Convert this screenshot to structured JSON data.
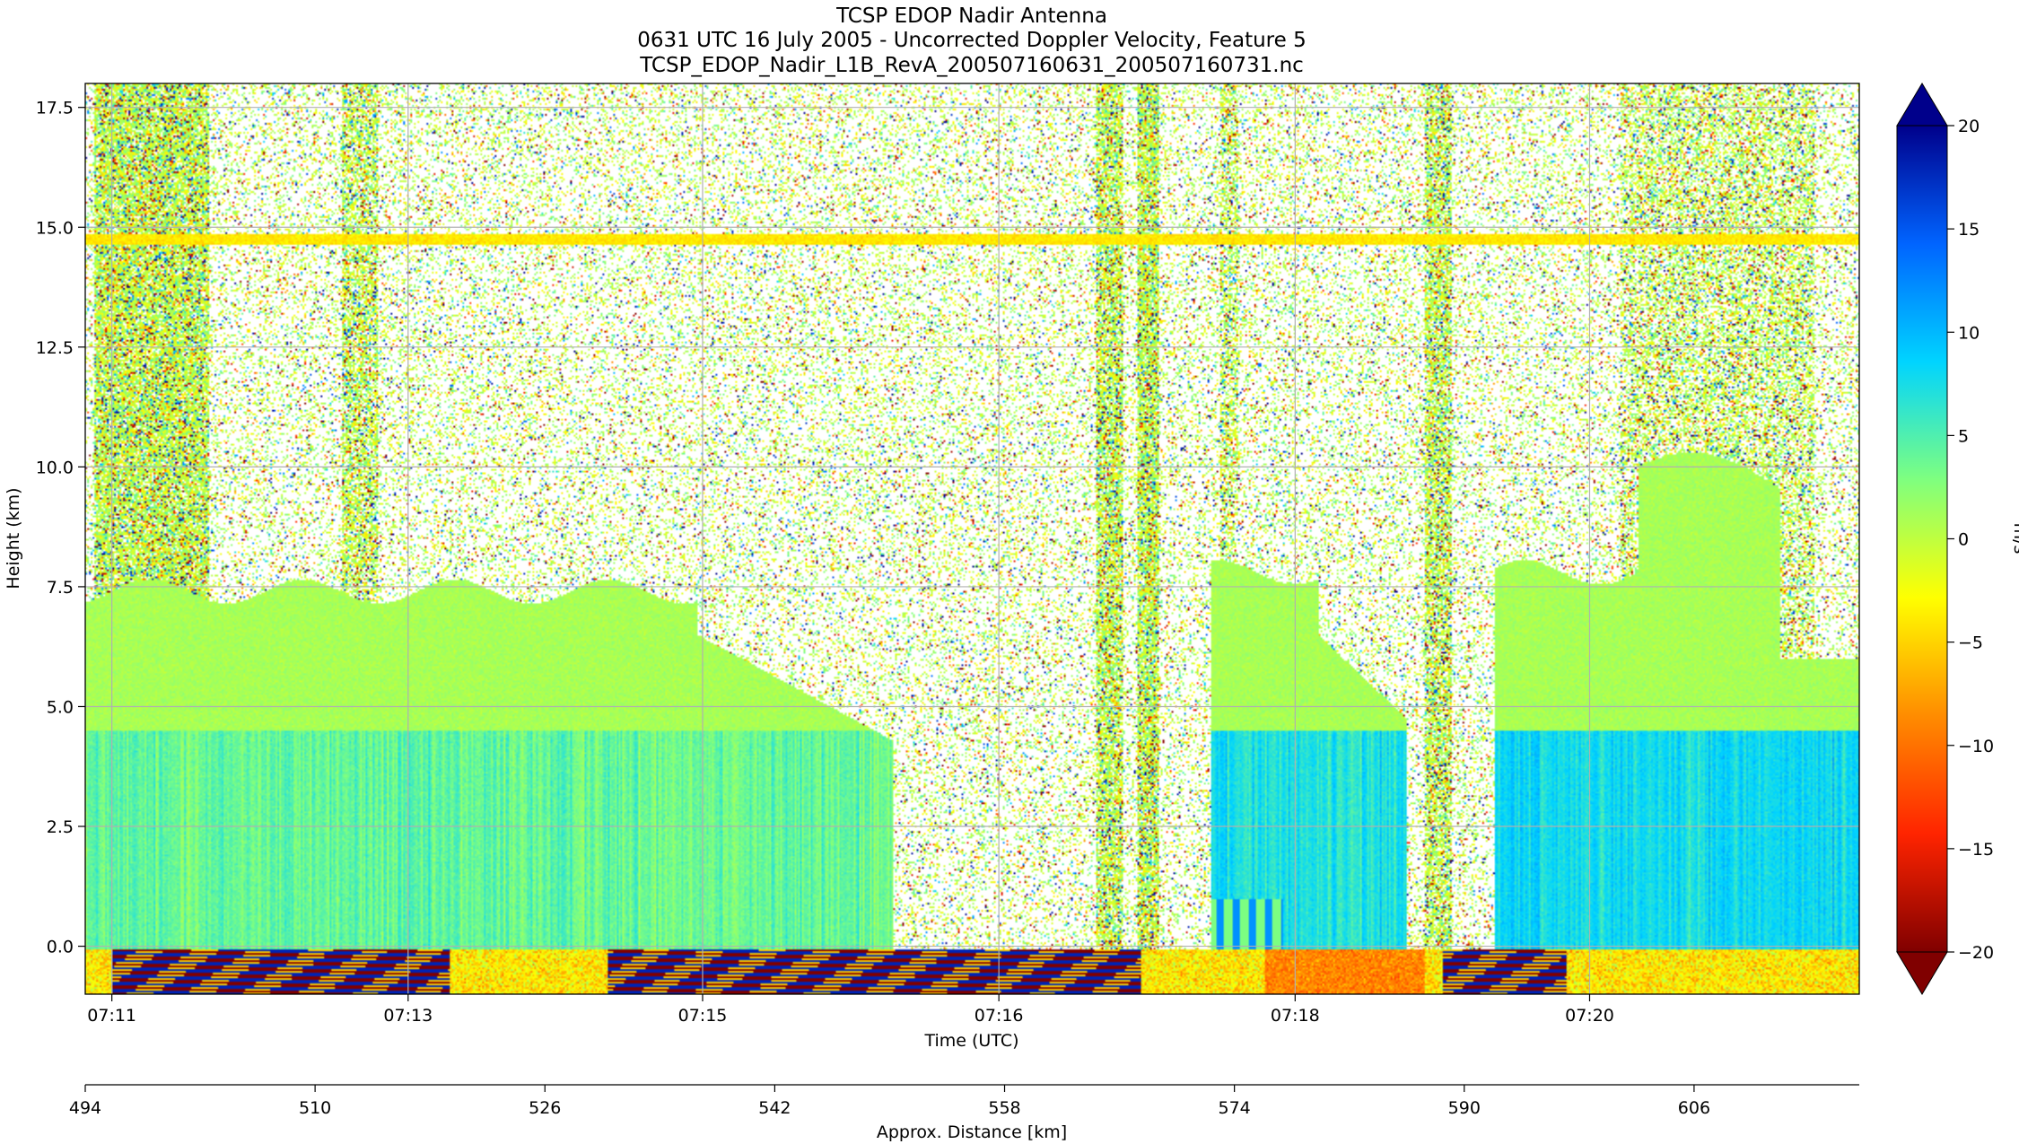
{
  "chart_data": {
    "type": "heatmap",
    "title_lines": [
      "TCSP EDOP Nadir Antenna",
      "0631 UTC 16 July 2005 - Uncorrected Doppler Velocity, Feature 5",
      "TCSP_EDOP_Nadir_L1B_RevA_200507160631_200507160731.nc"
    ],
    "xlabel": "Time (UTC)",
    "ylabel": "Height (km)",
    "x2label": "Approx. Distance [km]",
    "colorbar_label": "m/s",
    "colormap": "jet_r",
    "colormap_stops": [
      "#800000",
      "#ff2400",
      "#ff8c00",
      "#ffff00",
      "#7fff7f",
      "#00d4ff",
      "#0064ff",
      "#00008b"
    ],
    "clim": [
      -20,
      20
    ],
    "colorbar_extend": "both",
    "grid": true,
    "ylim": [
      -1.0,
      18.0
    ],
    "xlim_minutes_after_0711": [
      -0.15,
      9.85
    ],
    "x_ticks": [
      "07:11",
      "07:13",
      "07:15",
      "07:16",
      "07:18",
      "07:20"
    ],
    "x_tick_positions_minutes": [
      0,
      1.67,
      3.33,
      5.0,
      6.67,
      8.33
    ],
    "y_ticks": [
      0.0,
      2.5,
      5.0,
      7.5,
      10.0,
      12.5,
      15.0,
      17.5
    ],
    "y_tick_labels": [
      "0.0",
      "2.5",
      "5.0",
      "7.5",
      "10.0",
      "12.5",
      "15.0",
      "17.5"
    ],
    "x2_ticks": [
      "494",
      "510",
      "526",
      "542",
      "558",
      "574",
      "590",
      "606"
    ],
    "x2_range_km": [
      494,
      617.5
    ],
    "cbar_ticks": [
      20,
      15,
      10,
      5,
      0,
      -5,
      -10,
      -15,
      -20
    ],
    "cbar_tick_labels": [
      "20",
      "15",
      "10",
      "5",
      "0",
      "−5",
      "−10",
      "−15",
      "−20"
    ],
    "features": {
      "surface_height_km": 0.0,
      "anvil_band_height_km": 14.75,
      "echo_regions": [
        {
          "start_min": -0.15,
          "end_min": 4.4,
          "top_km": 7.4,
          "core_top_km": 4.5,
          "core_velocity": 4
        },
        {
          "start_min": 6.2,
          "end_min": 7.3,
          "top_km": 7.8,
          "core_top_km": 4.5,
          "core_velocity": 7
        },
        {
          "start_min": 7.8,
          "end_min": 9.85,
          "top_km": 7.8,
          "core_top_km": 4.5,
          "core_velocity": 8
        }
      ]
    }
  }
}
